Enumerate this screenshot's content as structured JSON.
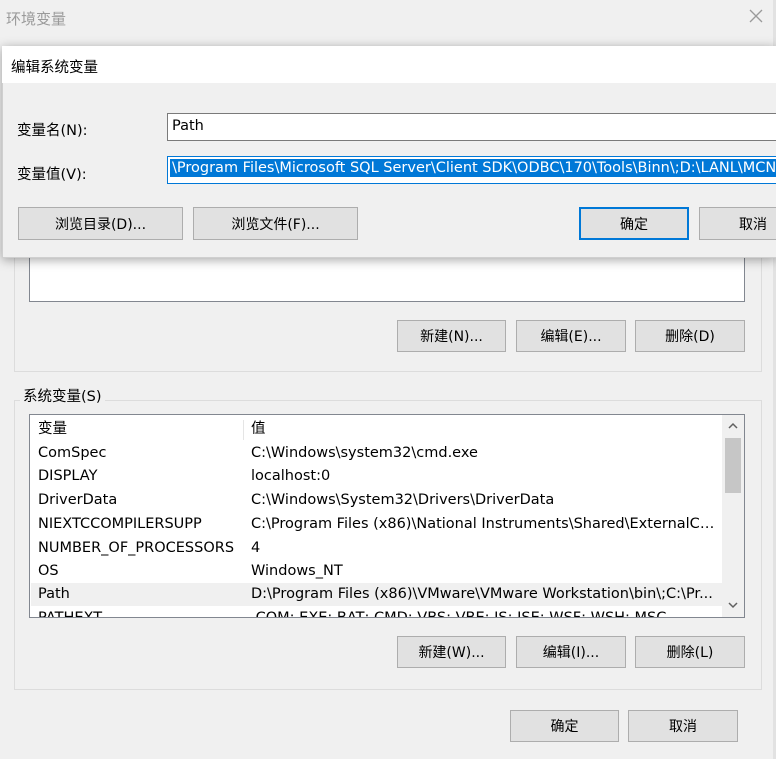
{
  "window": {
    "title": "环境变量",
    "close_icon": "close-icon"
  },
  "user_section": {
    "buttons": {
      "new": "新建(N)...",
      "edit": "编辑(E)...",
      "delete": "删除(D)"
    }
  },
  "system_section": {
    "label": "系统变量(S)",
    "columns": {
      "name": "变量",
      "value": "值"
    },
    "rows": [
      {
        "name": "ComSpec",
        "value": "C:\\Windows\\system32\\cmd.exe"
      },
      {
        "name": "DISPLAY",
        "value": "localhost:0"
      },
      {
        "name": "DriverData",
        "value": "C:\\Windows\\System32\\Drivers\\DriverData"
      },
      {
        "name": "NIEXTCCOMPILERSUPP",
        "value": "C:\\Program Files (x86)\\National Instruments\\Shared\\ExternalCo..."
      },
      {
        "name": "NUMBER_OF_PROCESSORS",
        "value": "4"
      },
      {
        "name": "OS",
        "value": "Windows_NT"
      },
      {
        "name": "Path",
        "value": "D:\\Program Files (x86)\\VMware\\VMware Workstation\\bin\\;C:\\Pr..."
      },
      {
        "name": "PATHEXT",
        "value": ".COM;.EXE;.BAT;.CMD;.VBS;.VBE;.JS;.JSE;.WSF;.WSH;.MSC"
      }
    ],
    "buttons": {
      "new": "新建(W)...",
      "edit": "编辑(I)...",
      "delete": "删除(L)"
    }
  },
  "footer": {
    "ok": "确定",
    "cancel": "取消"
  },
  "dialog": {
    "title": "编辑系统变量",
    "name_label": "变量名(N):",
    "name_value": "Path",
    "value_label": "变量值(V):",
    "value_text": "\\Program Files\\Microsoft SQL Server\\Client SDK\\ODBC\\170\\Tools\\Binn\\;D:\\LANL\\MCNP",
    "buttons": {
      "browse_dir": "浏览目录(D)...",
      "browse_file": "浏览文件(F)...",
      "ok": "确定",
      "cancel": "取消"
    }
  },
  "colors": {
    "selection": "#0078d7",
    "button_face": "#e1e1e1",
    "window_bg": "#f0f0f0"
  }
}
